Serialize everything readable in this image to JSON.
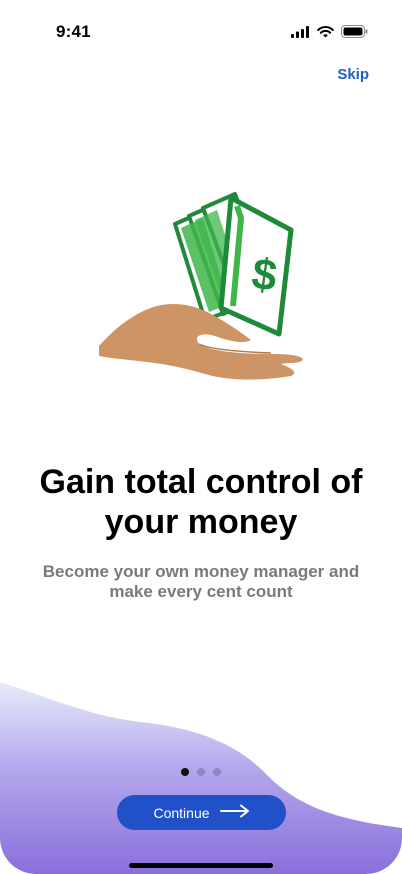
{
  "status_bar": {
    "time": "9:41"
  },
  "header": {
    "skip_label": "Skip"
  },
  "onboarding": {
    "headline": "Gain total control of your money",
    "subtitle": "Become your own money manager and make every cent count",
    "page_count": 3,
    "active_page": 1
  },
  "actions": {
    "continue_label": "Continue"
  },
  "icons": {
    "hero": "hand-holding-money-icon",
    "signal": "cellular-signal-icon",
    "wifi": "wifi-icon",
    "battery": "battery-icon",
    "arrow": "arrow-right-icon"
  },
  "colors": {
    "accent": "#2151c8",
    "link": "#1f5fcf",
    "money_green": "#1f8a3a",
    "hand": "#cd9566",
    "wave": "#8e73dc"
  }
}
